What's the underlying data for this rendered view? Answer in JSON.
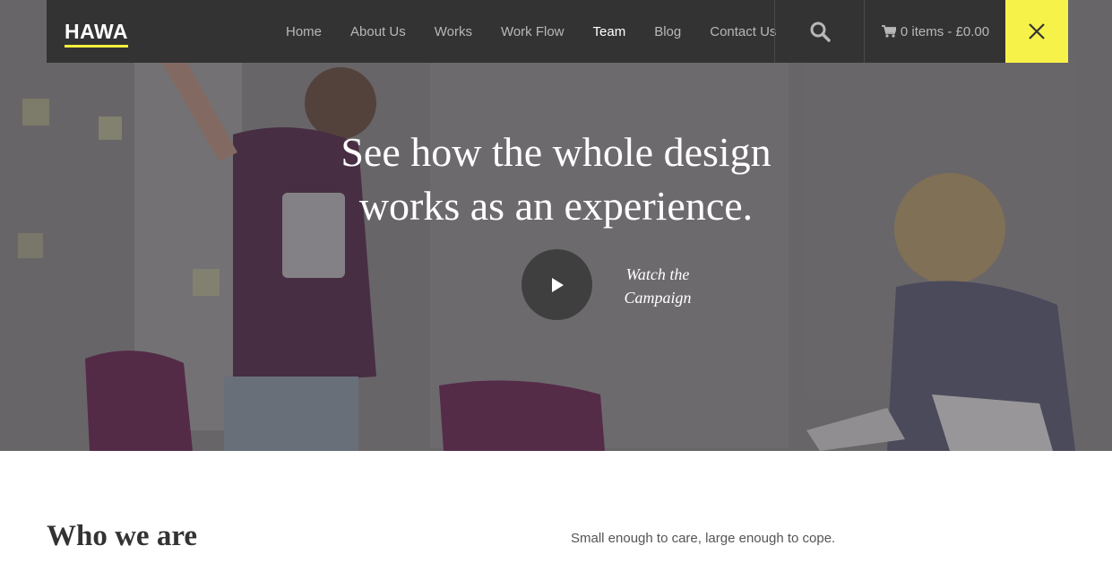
{
  "brand": {
    "logo": "HAWA",
    "accent": "#f6f24a",
    "nav_bg": "#333333"
  },
  "nav": {
    "items": [
      {
        "label": "Home",
        "active": false
      },
      {
        "label": "About Us",
        "active": false
      },
      {
        "label": "Works",
        "active": false
      },
      {
        "label": "Work Flow",
        "active": false
      },
      {
        "label": "Team",
        "active": true
      },
      {
        "label": "Blog",
        "active": false
      },
      {
        "label": "Contact Us",
        "active": false
      }
    ],
    "search_icon": "search-icon",
    "cart_icon": "cart-icon",
    "cart_label": "0 items - £0.00",
    "close_icon": "close-icon"
  },
  "hero": {
    "headline_line1": "See how the whole design",
    "headline_line2": "works as an experience.",
    "play_icon": "play-icon",
    "watch_line1": "Watch the",
    "watch_line2": "Campaign"
  },
  "about": {
    "heading": "Who we are",
    "tagline": "Small enough to care, large enough to cope."
  }
}
